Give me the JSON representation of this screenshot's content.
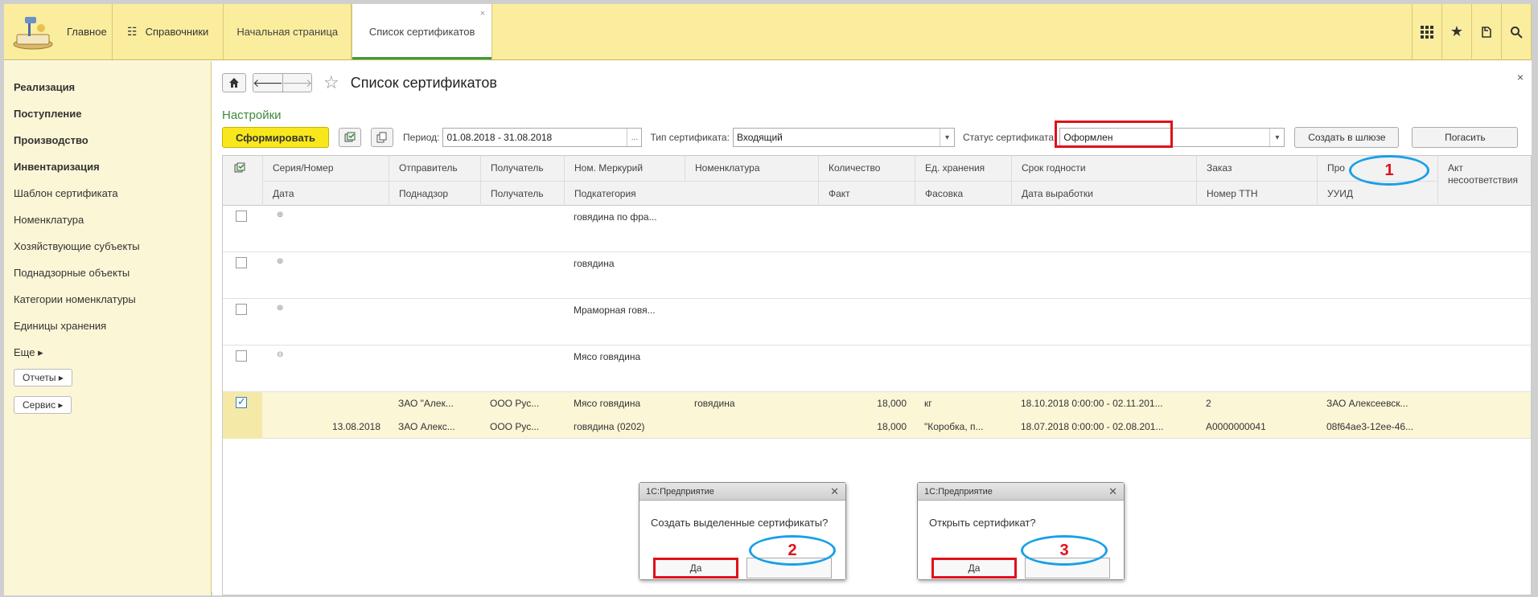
{
  "topbar": {
    "home_label": "Главное",
    "section_label": "Справочники",
    "tabs": [
      {
        "label": "Начальная страница"
      },
      {
        "label": "Список сертификатов"
      }
    ],
    "tab_close": "×",
    "icons": [
      "apps-grid-icon",
      "star-icon",
      "history-icon",
      "search-icon"
    ]
  },
  "sidebar": {
    "items": [
      {
        "label": "Реализация",
        "bold": true
      },
      {
        "label": "Поступление",
        "bold": true
      },
      {
        "label": "Производство",
        "bold": true
      },
      {
        "label": "Инвентаризация",
        "bold": true
      },
      {
        "label": "Шаблон сертификата",
        "bold": false
      },
      {
        "label": "Номенклатура",
        "bold": false
      },
      {
        "label": "Хозяйствующие субъекты",
        "bold": false
      },
      {
        "label": "Поднадзорные объекты",
        "bold": false
      },
      {
        "label": "Категории номенклатуры",
        "bold": false
      },
      {
        "label": "Единицы хранения",
        "bold": false
      },
      {
        "label": "Еще ▸",
        "bold": false
      }
    ],
    "buttons": [
      "Отчеты ▸",
      "Сервис ▸"
    ]
  },
  "main": {
    "title": "Список сертификатов",
    "settings_link": "Настройки",
    "form_button": "Сформировать",
    "period_label": "Период:",
    "period_value": "01.08.2018 - 31.08.2018",
    "period_suffix": "...",
    "type_label": "Тип сертификата:",
    "type_value": "Входящий",
    "status_label": "Статус сертификата:",
    "status_value": "Оформлен",
    "create_gateway_button": "Создать в шлюзе",
    "redeem_button": "Погасить",
    "close": "×"
  },
  "table": {
    "header_row1": [
      "Серия/Номер",
      "Отправитель",
      "Получатель",
      "Ном. Меркурий",
      "Номенклатура",
      "Количество",
      "Ед. хранения",
      "Срок годности",
      "Заказ",
      "Про",
      "Акт несоответствия"
    ],
    "header_row2": [
      "Дата",
      "Поднадзор",
      "Получатель",
      "Подкатегория",
      "Факт",
      "Фасовка",
      "Дата выработки",
      "Номер ТТН",
      "УУИД"
    ],
    "groups": [
      {
        "name": "говядина по фра...",
        "expander": "⊕"
      },
      {
        "name": "говядина",
        "expander": "⊕"
      },
      {
        "name": "Мраморная говя...",
        "expander": "⊕"
      },
      {
        "name": "Мясо говядина",
        "expander": "⊖"
      }
    ],
    "record": {
      "r1": {
        "sender": "ЗАО \"Алек...",
        "receiver": "ООО Рус...",
        "merc": "Мясо говядина",
        "nomen": "говядина",
        "qty": "18,000",
        "unit": "кг",
        "expiry": "18.10.2018 0:00:00 - 02.11.201...",
        "order": "2",
        "producer": "ЗАО Алексеевск..."
      },
      "r2": {
        "date": "13.08.2018",
        "supervisor": "ЗАО Алекс...",
        "receiver": "ООО Рус...",
        "subcat": "говядина (0202)",
        "fact": "18,000",
        "pack": "\"Коробка, п...",
        "prod_date": "18.07.2018 0:00:00 - 02.08.201...",
        "ttn": "А0000000041",
        "uuid": "08f64ae3-12ee-46..."
      }
    }
  },
  "dialogs": [
    {
      "title": "1С:Предприятие",
      "message": "Создать выделенные сертификаты?",
      "yes": "Да",
      "marker": "2"
    },
    {
      "title": "1С:Предприятие",
      "message": "Открыть сертификат?",
      "yes": "Да",
      "marker": "3"
    }
  ],
  "annotations": {
    "marker1": "1"
  },
  "colors": {
    "topbar": "#fbed9e",
    "sidebar": "#fbf6d6",
    "accent_yellow": "#f8e81b",
    "annotation_red": "#e0101a",
    "annotation_blue": "#1aa0e6",
    "link_green": "#3c8a3c"
  }
}
